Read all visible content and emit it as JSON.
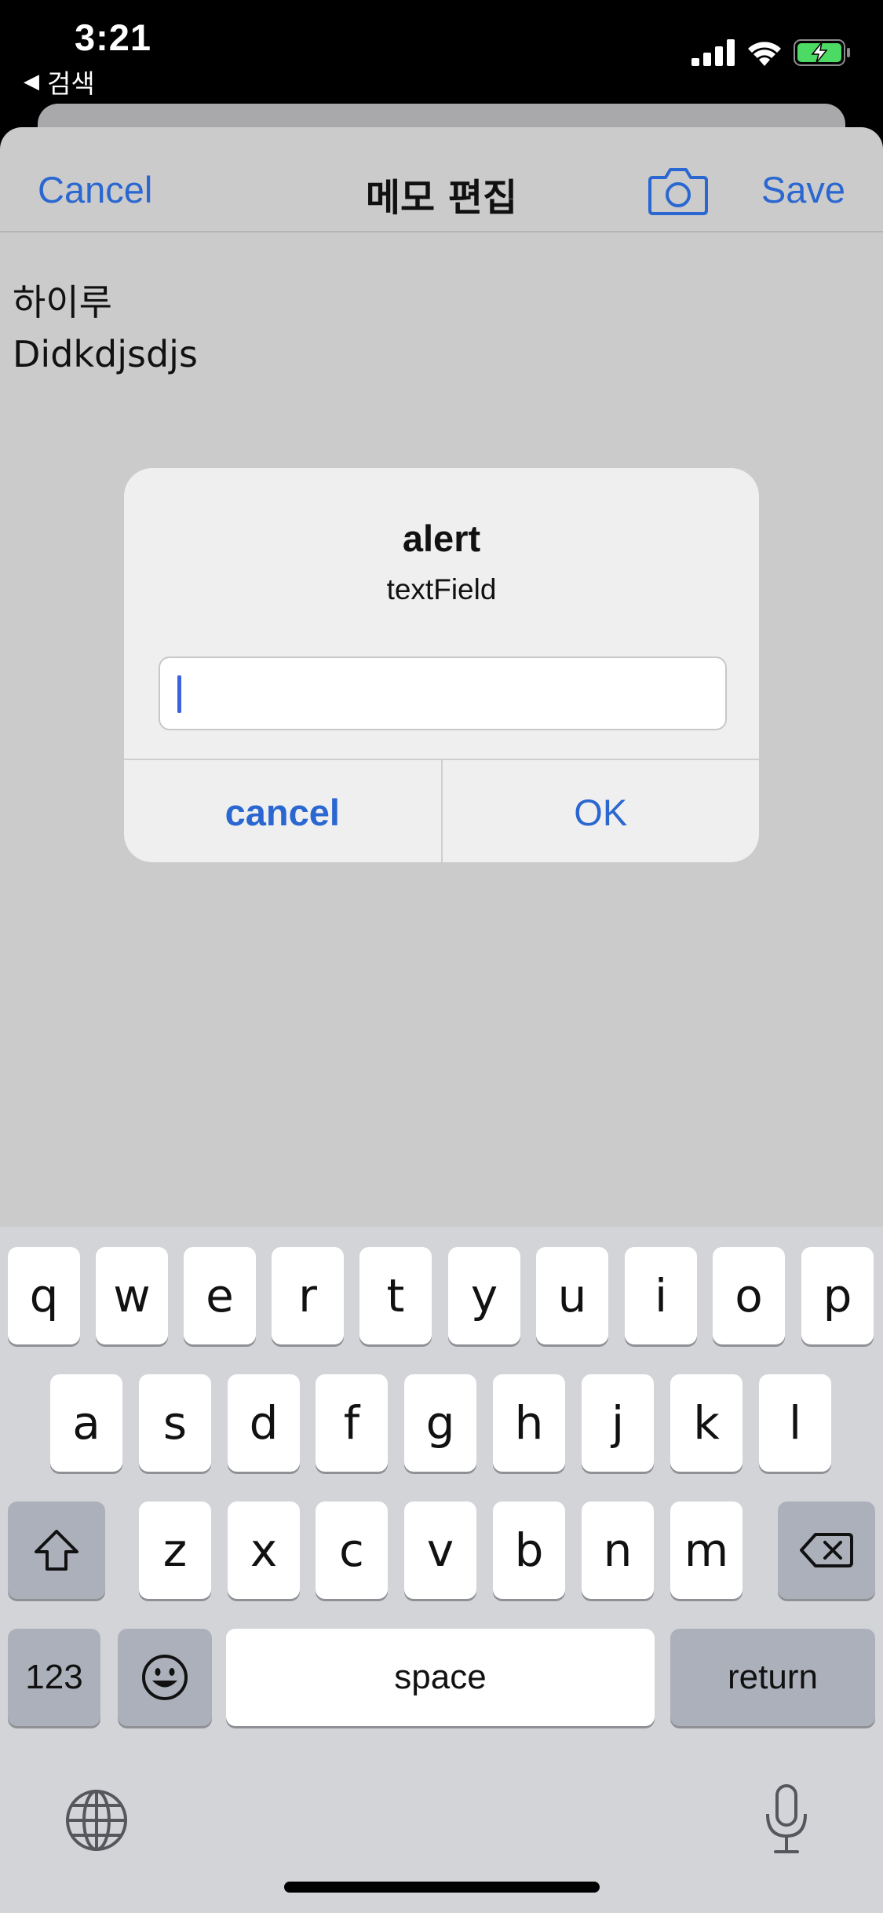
{
  "status_bar": {
    "time": "3:21",
    "back_app": "검색",
    "back_arrow": "◀"
  },
  "nav": {
    "cancel": "Cancel",
    "title": "메모 편집",
    "save": "Save",
    "camera_icon": "camera-icon"
  },
  "memo": {
    "lines": [
      "하이루",
      "Didkdjsdjs"
    ]
  },
  "alert": {
    "title": "alert",
    "message": "textField",
    "input_value": "",
    "cancel": "cancel",
    "ok": "OK"
  },
  "keyboard": {
    "row1": [
      "q",
      "w",
      "e",
      "r",
      "t",
      "y",
      "u",
      "i",
      "o",
      "p"
    ],
    "row2": [
      "a",
      "s",
      "d",
      "f",
      "g",
      "h",
      "j",
      "k",
      "l"
    ],
    "row3": [
      "z",
      "x",
      "c",
      "v",
      "b",
      "n",
      "m"
    ],
    "numbers": "123",
    "space": "space",
    "return": "return",
    "icons": [
      "shift-icon",
      "delete-icon",
      "emoji-icon",
      "globe-icon",
      "microphone-icon"
    ]
  },
  "colors": {
    "accent": "#2a67d0",
    "sheet": "#cbcbcc",
    "keyboard": "#d3d4d8",
    "battery": "#4cd964"
  }
}
